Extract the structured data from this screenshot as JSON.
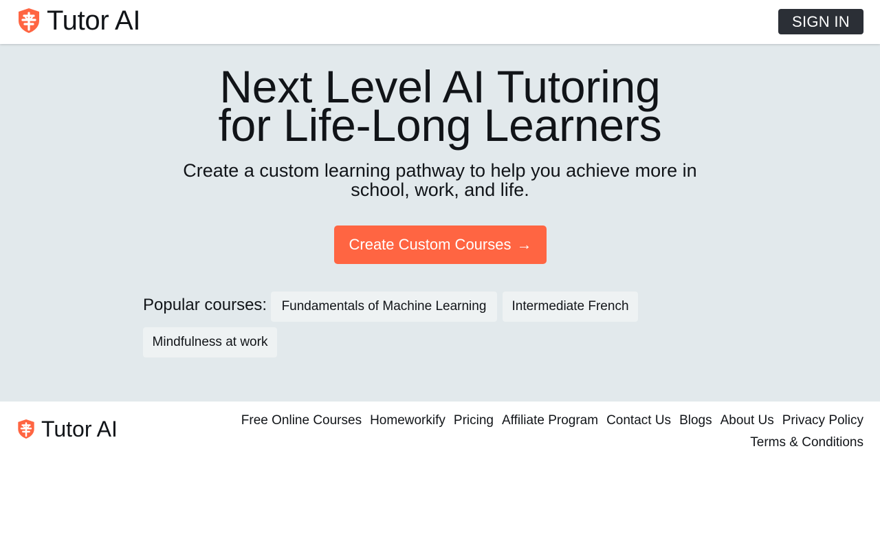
{
  "header": {
    "brand": "Tutor AI",
    "sign_in": "SIGN IN"
  },
  "hero": {
    "title_line1": "Next Level AI Tutoring",
    "title_line2": "for Life-Long Learners",
    "subtitle": "Create a custom learning pathway to help you achieve more in school, work, and life.",
    "cta_label": "Create Custom Courses",
    "cta_arrow": "→"
  },
  "popular": {
    "label": "Popular courses:",
    "courses": [
      "Fundamentals of Machine Learning",
      "Intermediate French",
      "Mindfulness at work"
    ]
  },
  "footer": {
    "brand": "Tutor AI",
    "links": [
      "Free Online Courses",
      "Homeworkify",
      "Pricing",
      "Affiliate Program",
      "Contact Us",
      "Blogs",
      "About Us",
      "Privacy Policy",
      "Terms & Conditions"
    ]
  },
  "colors": {
    "accent": "#ff6542",
    "hero_bg": "#e2e9ec",
    "sign_in_bg": "#2b2f36",
    "chip_bg": "#eef2f3"
  },
  "icons": {
    "logo": "shield-logo-icon",
    "cta": "arrow-right-icon"
  }
}
